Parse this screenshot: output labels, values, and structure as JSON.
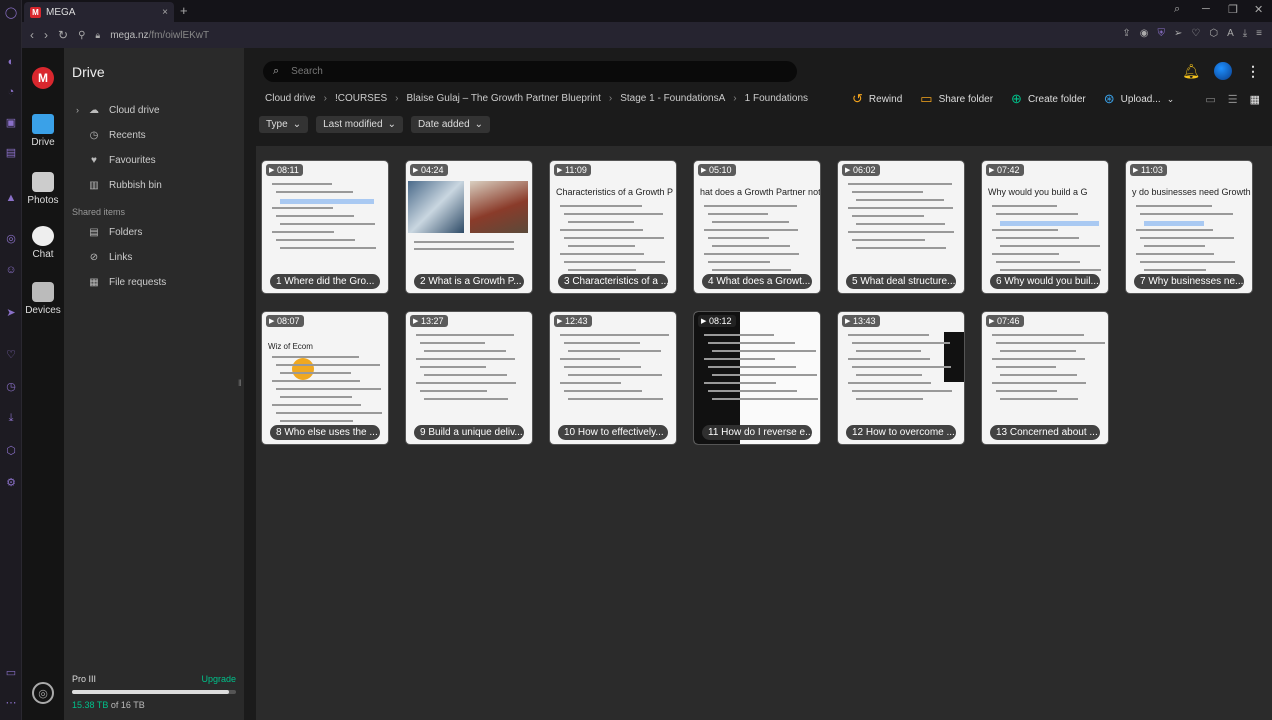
{
  "browser": {
    "tab_title": "MEGA",
    "tab_close": "×",
    "new_tab": "+",
    "url_host": "mega.nz",
    "url_path": "/fm/oiwlEKwT",
    "tab_favicon_text": "M",
    "window_controls": [
      "⌕",
      "─",
      "❐",
      "✕"
    ]
  },
  "rail": {
    "logo_text": "M",
    "items": [
      {
        "label": "Drive",
        "icon": "folder-icon"
      },
      {
        "label": "Photos",
        "icon": "photo-icon"
      },
      {
        "label": "Chat",
        "icon": "chat-icon"
      },
      {
        "label": "Devices",
        "icon": "devices-icon"
      }
    ]
  },
  "sidebar": {
    "title": "Drive",
    "items": [
      {
        "label": "Cloud drive",
        "icon": "cloud-icon"
      },
      {
        "label": "Recents",
        "icon": "clock-icon"
      },
      {
        "label": "Favourites",
        "icon": "heart-icon"
      },
      {
        "label": "Rubbish bin",
        "icon": "trash-icon"
      }
    ],
    "shared_title": "Shared items",
    "shared_items": [
      {
        "label": "Folders",
        "icon": "shared-folder-icon"
      },
      {
        "label": "Links",
        "icon": "link-icon"
      },
      {
        "label": "File requests",
        "icon": "file-request-icon"
      }
    ],
    "storage": {
      "plan": "Pro III",
      "upgrade": "Upgrade",
      "used": "15.38 TB",
      "of_total": "of 16 TB",
      "fraction": 0.96
    }
  },
  "search": {
    "placeholder": "Search"
  },
  "breadcrumb": [
    "Cloud drive",
    "!COURSES",
    "Blaise Gulaj – The Growth Partner Blueprint",
    "Stage 1 - FoundationsA",
    "1 Foundations"
  ],
  "actions": {
    "rewind": "Rewind",
    "share_folder": "Share folder",
    "create_folder": "Create folder",
    "upload": "Upload..."
  },
  "filters": [
    "Type",
    "Last modified",
    "Date added"
  ],
  "files": [
    {
      "name": "1 Where did the Gro...",
      "duration": "08:11"
    },
    {
      "name": "2 What is a Growth P...",
      "duration": "04:24"
    },
    {
      "name": "3 Characteristics of a ...",
      "duration": "11:09",
      "heading": "Characteristics of a Growth P"
    },
    {
      "name": "4 What does a Growt...",
      "duration": "05:10",
      "heading": "hat does a Growth Partner not"
    },
    {
      "name": "5 What deal structure...",
      "duration": "06:02"
    },
    {
      "name": "6 Why would you buil...",
      "duration": "07:42",
      "heading": "Why would you build a G"
    },
    {
      "name": "7 Why businesses ne...",
      "duration": "11:03",
      "heading": "y do businesses need Growth"
    },
    {
      "name": "8 Who else uses the ...",
      "duration": "08:07",
      "heading": "Wiz of Ecom"
    },
    {
      "name": "9 Build a unique deliv...",
      "duration": "13:27"
    },
    {
      "name": "10 How to effectively...",
      "duration": "12:43"
    },
    {
      "name": "11 How do I reverse e...",
      "duration": "08:12"
    },
    {
      "name": "12 How to overcome ...",
      "duration": "13:43"
    },
    {
      "name": "13 Concerned about ...",
      "duration": "07:46"
    }
  ]
}
